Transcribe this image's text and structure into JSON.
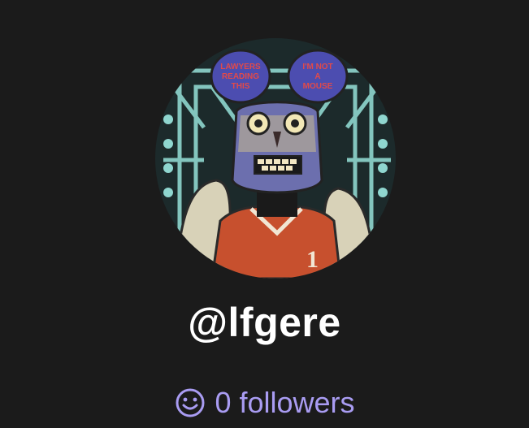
{
  "profile": {
    "handle": "@lfgere",
    "followers_count": "0",
    "followers_label": "followers",
    "followers_icon": "smiley-icon",
    "colors": {
      "background": "#1b1b1b",
      "handle_text": "#ffffff",
      "followers_text": "#a99cf2"
    },
    "avatar": {
      "ear_left_text": [
        "LAWYERS",
        "READING",
        "THIS"
      ],
      "ear_right_text": [
        "I'M NOT",
        "A",
        "MOUSE"
      ],
      "jersey_number": "1"
    }
  }
}
